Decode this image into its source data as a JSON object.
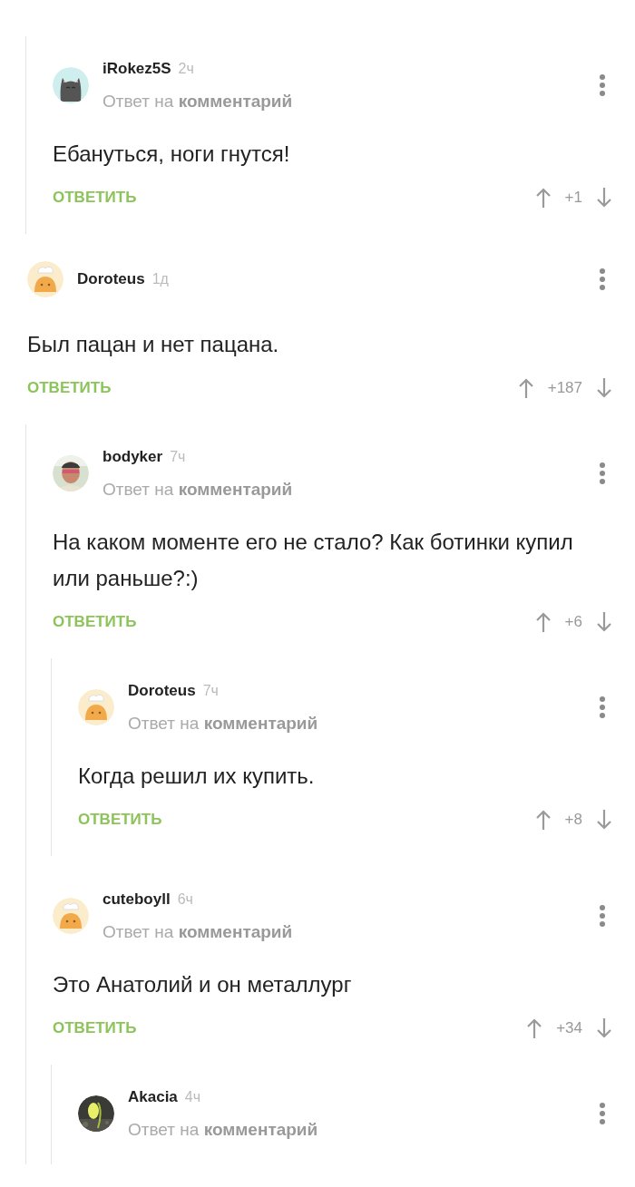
{
  "comments": [
    {
      "children": [
        {
          "author": "iRokez5S",
          "time": "2ч",
          "avatar": {
            "kind": "cat"
          },
          "reply_to": "Ответ на **комментарий**",
          "text": "Ебануться, ноги гнутся!",
          "reply": "ОТВЕТИТЬ",
          "rating": "+1"
        }
      ]
    },
    {
      "author": "Doroteus",
      "time": "1д",
      "avatar": {
        "kind": "bun"
      },
      "text": "Был пацан и нет пацана.",
      "reply": "ОТВЕТИТЬ",
      "rating": "+187",
      "children": [
        {
          "author": "bodyker",
          "time": "7ч",
          "avatar": {
            "kind": "portrait"
          },
          "reply_to": "Ответ на **комментарий**",
          "text": "На каком моменте его не стало? Как ботинки купил или раньше?:)",
          "reply": "ОТВЕТИТЬ",
          "rating": "+6",
          "children": [
            {
              "author": "Doroteus",
              "time": "7ч",
              "avatar": {
                "kind": "bun"
              },
              "reply_to": "Ответ на **комментарий**",
              "text": "Когда решил их купить.",
              "reply": "ОТВЕТИТЬ",
              "rating": "+8"
            }
          ]
        },
        {
          "author": "cuteboyll",
          "time": "6ч",
          "avatar": {
            "kind": "bun"
          },
          "reply_to": "Ответ на **комментарий**",
          "text": "Это Анатолий и он металлург",
          "reply": "ОТВЕТИТЬ",
          "rating": "+34",
          "children": [
            {
              "author": "Akacia",
              "time": "4ч",
              "avatar": {
                "kind": "sprout"
              },
              "reply_to": "Ответ на **комментарий**"
            }
          ]
        }
      ]
    }
  ]
}
